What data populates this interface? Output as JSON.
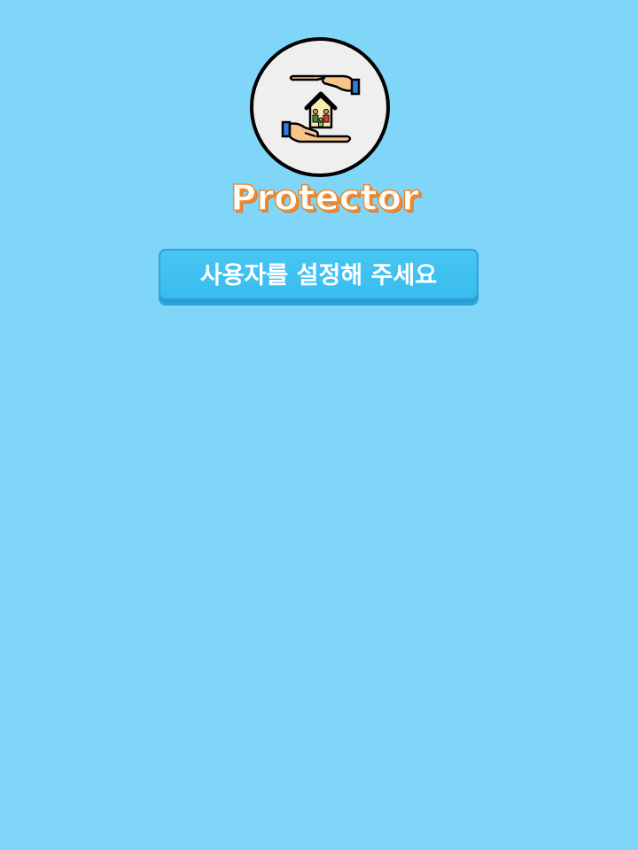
{
  "app": {
    "name": "Protector",
    "logo_icon": "hands-protecting-house-icon"
  },
  "setup": {
    "button_label": "사용자를 설정해 주세요"
  },
  "colors": {
    "background": "#7fd6f8",
    "button": "#40c2f2",
    "title_outline": "#f08a2c"
  }
}
